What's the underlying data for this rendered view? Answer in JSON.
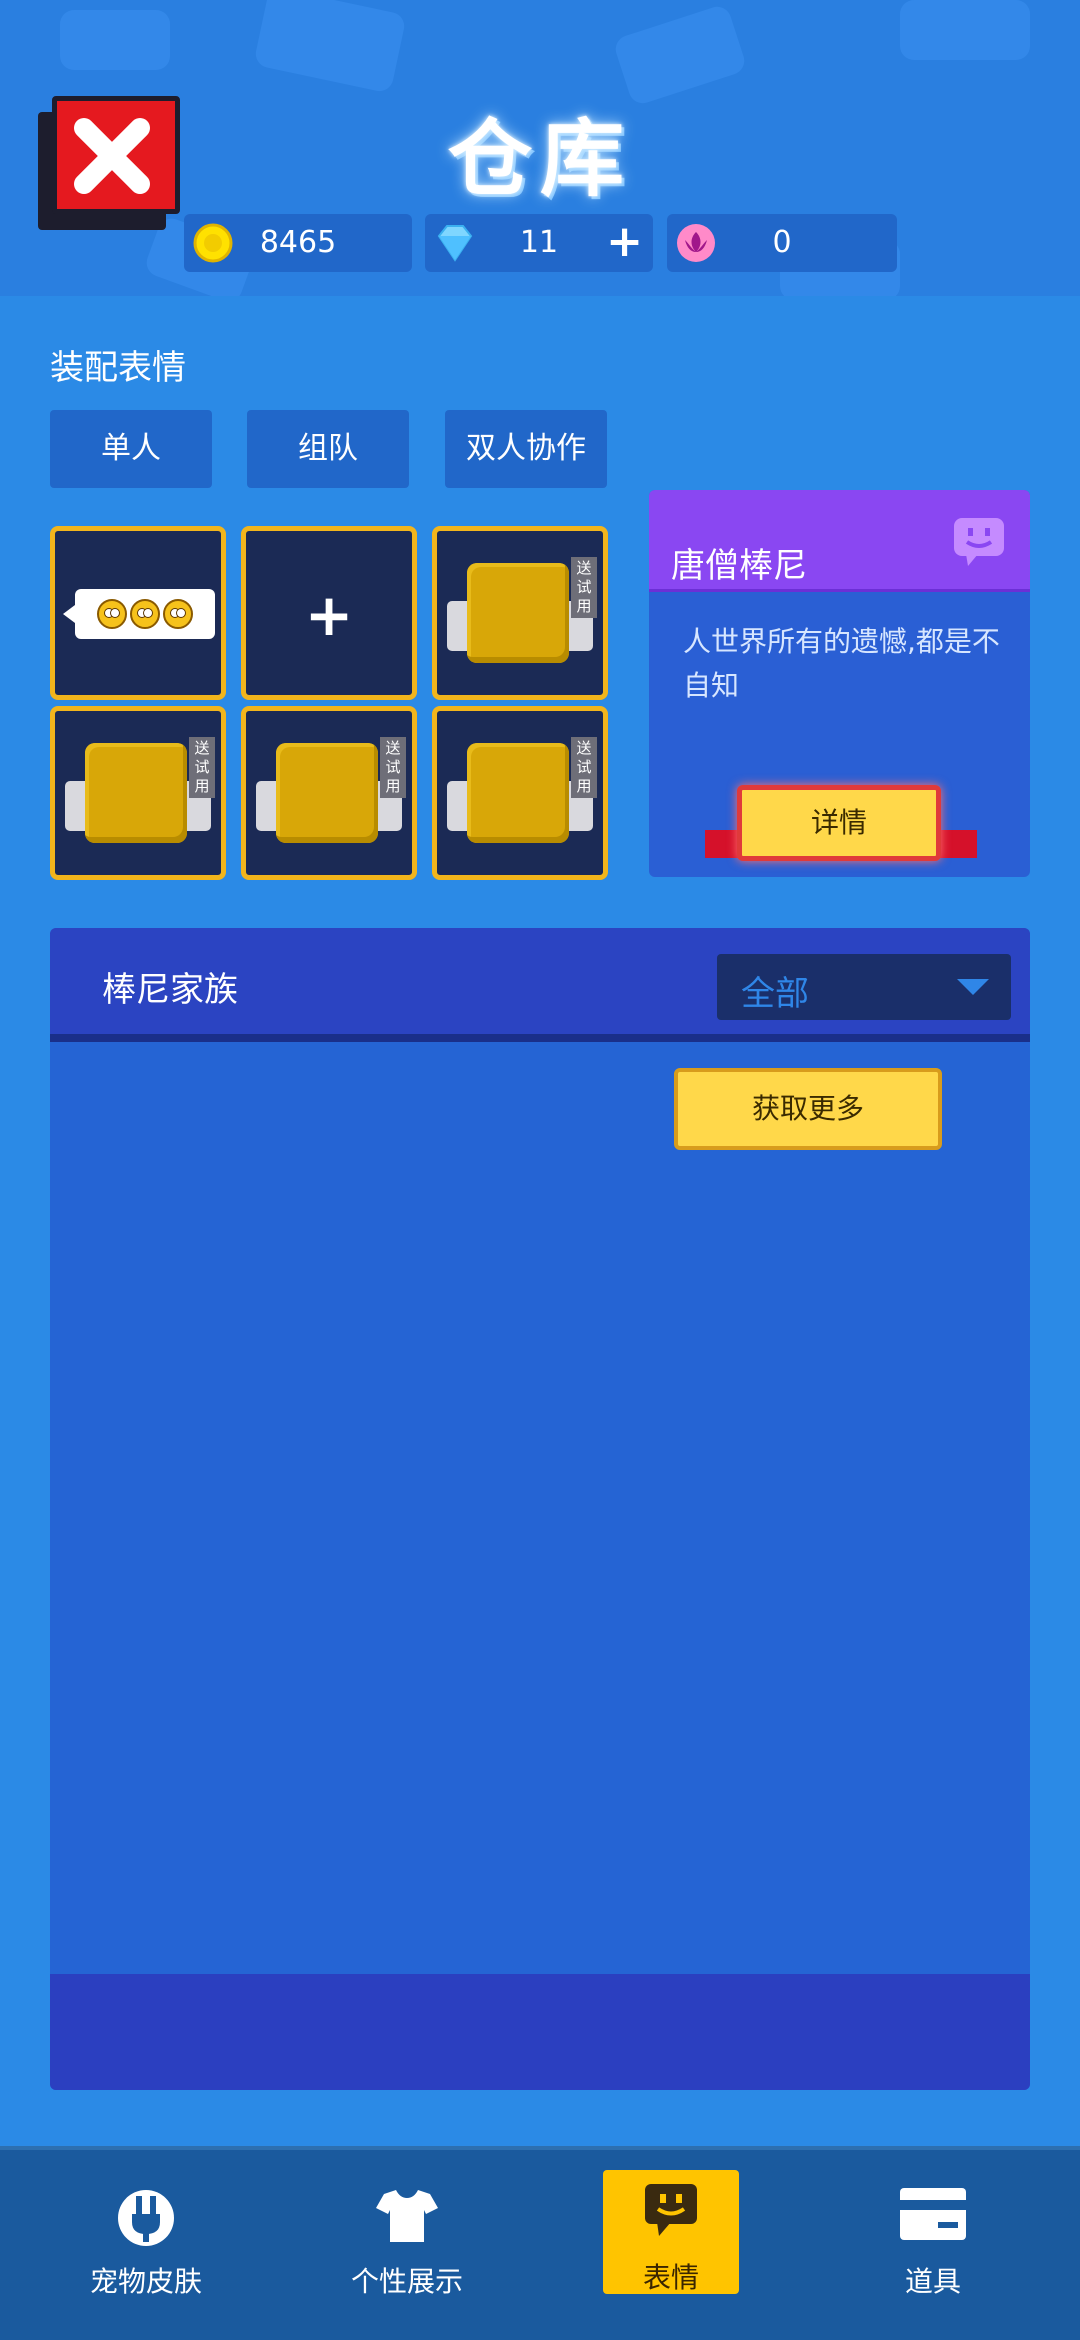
{
  "header": {
    "title": "仓库",
    "currencies": [
      {
        "icon": "gold-coin-icon",
        "value": "8465"
      },
      {
        "icon": "diamond-icon",
        "value": "11",
        "plus": "+"
      },
      {
        "icon": "lotus-icon",
        "value": "0"
      }
    ]
  },
  "equip": {
    "section_title": "装配表情",
    "tabs": [
      "单人",
      "组队",
      "双人协作"
    ],
    "slots": [
      {
        "kind": "emoji"
      },
      {
        "kind": "add",
        "label": "+"
      },
      {
        "kind": "trial",
        "tag": "送试用"
      },
      {
        "kind": "trial",
        "tag": "送试用"
      },
      {
        "kind": "trial",
        "tag": "送试用"
      },
      {
        "kind": "trial",
        "tag": "送试用"
      }
    ]
  },
  "card": {
    "name": "唐僧棒尼",
    "description": "人世界所有的遗憾,都是不自知",
    "detail_label": "详情"
  },
  "family": {
    "title": "棒尼家族",
    "filter_value": "全部",
    "more_label": "获取更多"
  },
  "nav": {
    "items": [
      {
        "label": "宠物皮肤",
        "icon": "pet-skin-icon",
        "active": false
      },
      {
        "label": "个性展示",
        "icon": "shirt-icon",
        "active": false
      },
      {
        "label": "表情",
        "icon": "emote-icon",
        "active": true
      },
      {
        "label": "道具",
        "icon": "card-icon",
        "active": false
      }
    ]
  },
  "colors": {
    "background": "#2b8ae6",
    "slot_border": "#f2b51c",
    "card_header": "#8a47f2",
    "button_yellow": "#ffd84a",
    "nav_active": "#ffc400"
  }
}
